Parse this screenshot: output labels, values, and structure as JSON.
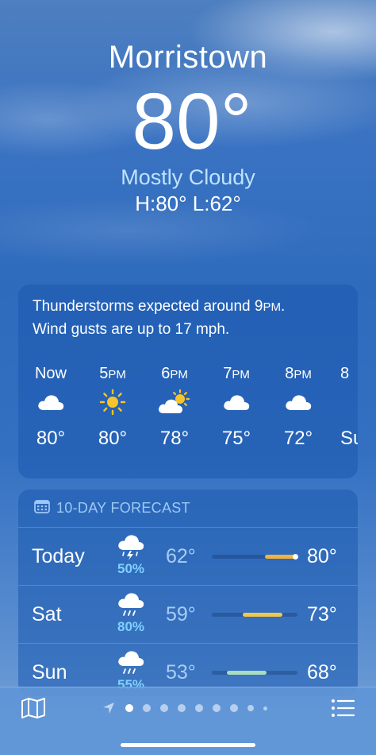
{
  "header": {
    "city": "Morristown",
    "temperature": "80°",
    "condition": "Mostly Cloudy",
    "high_low": "H:80°  L:62°"
  },
  "hourly": {
    "alert_line1_pre": "Thunderstorms expected around 9",
    "alert_line1_sc": "PM",
    "alert_line1_post": ".",
    "alert_line2": "Wind gusts are up to 17 mph.",
    "hours": [
      {
        "time": "Now",
        "suffix": "",
        "icon": "cloud-icon",
        "temp": "80°"
      },
      {
        "time": "5",
        "suffix": "PM",
        "icon": "sun-icon",
        "temp": "80°"
      },
      {
        "time": "6",
        "suffix": "PM",
        "icon": "partly-cloudy-icon",
        "temp": "78°"
      },
      {
        "time": "7",
        "suffix": "PM",
        "icon": "cloud-icon",
        "temp": "75°"
      },
      {
        "time": "8",
        "suffix": "PM",
        "icon": "cloud-icon",
        "temp": "72°"
      },
      {
        "time": "8",
        "suffix": "",
        "icon": "",
        "temp": "Su"
      }
    ]
  },
  "forecast": {
    "title": "10-DAY FORECAST",
    "days": [
      {
        "day": "Today",
        "icon": "thunderstorm-icon",
        "precip": "50%",
        "low": "62°",
        "high": "80°",
        "bar_start": 0.62,
        "bar_end": 1.0,
        "bar_color": "#f2b33a",
        "current": 1.0
      },
      {
        "day": "Sat",
        "icon": "rain-icon",
        "precip": "80%",
        "low": "59°",
        "high": "73°",
        "bar_start": 0.36,
        "bar_end": 0.82,
        "bar_color": "#f0c94a"
      },
      {
        "day": "Sun",
        "icon": "rain-icon",
        "precip": "55%",
        "low": "53°",
        "high": "68°",
        "bar_start": 0.18,
        "bar_end": 0.64,
        "bar_color": "#a9dcc0"
      }
    ]
  },
  "bottom": {
    "map_icon": "map-icon",
    "location_icon": "location-arrow-icon",
    "list_icon": "list-icon"
  }
}
